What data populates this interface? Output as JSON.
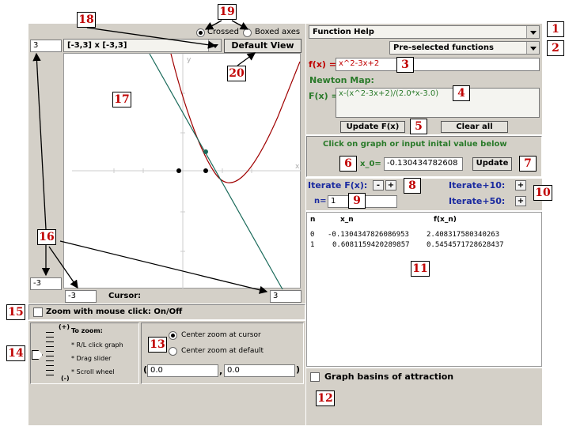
{
  "graph": {
    "left_max": "3",
    "left_min": "-3",
    "bottom_min": "-3",
    "bottom_max": "3",
    "window_select": "[-3,3] x [-3,3]",
    "default_view_label": "Default View",
    "cursor_label": "Cursor:",
    "axis_y_label": "y",
    "axis_x_label": "x",
    "axes_options": [
      "Crossed",
      "Boxed axes"
    ],
    "axes_selected": "Crossed"
  },
  "zoom": {
    "toggle_label": "Zoom with mouse click:  On/Off",
    "slider_plus": "(+)",
    "slider_minus": "(-)",
    "instructions_title": "To zoom:",
    "instructions": [
      "* R/L click graph",
      "* Drag slider",
      "* Scroll wheel"
    ],
    "center_options": [
      "Center zoom at cursor",
      "Center zoom at default"
    ],
    "center_selected": "Center zoom at cursor",
    "open_paren": "(",
    "coord_x": "0.0",
    "comma": ",",
    "coord_y": "0.0",
    "close_paren": ")"
  },
  "function_panel": {
    "help_select": "Function Help",
    "preselected_select": "Pre-selected functions",
    "fx_label": "f(x) =",
    "fx_value": "x^2-3x+2",
    "newton_map_label": "Newton Map:",
    "Fx_label": "F(x) =",
    "Fx_value": "x-(x^2-3x+2)/(2.0*x-3.0)",
    "update_button": "Update F(x)",
    "clear_button": "Clear all"
  },
  "initial": {
    "instruction": "Click on graph or input inital value below",
    "x0_label": "x_0=",
    "x0_value": "-0.130434782608",
    "update_button": "Update"
  },
  "iterate": {
    "label": "Iterate F(x):",
    "minus": "-",
    "plus": "+",
    "n_label": "n=",
    "n_value": "1",
    "iter10_label": "Iterate+10:",
    "iter50_label": "Iterate+50:"
  },
  "table": {
    "columns": [
      "n",
      "x_n",
      "f(x_n)"
    ],
    "rows": [
      [
        "0",
        "-0.1304347826086953",
        "2.408317580340263"
      ],
      [
        "1",
        "0.6081159420289857",
        "0.5454571728628437"
      ]
    ]
  },
  "basins": {
    "label": "Graph basins of attraction"
  },
  "callouts": [
    "1",
    "2",
    "3",
    "4",
    "5",
    "6",
    "7",
    "8",
    "9",
    "10",
    "11",
    "12",
    "13",
    "14",
    "15",
    "16",
    "17",
    "18",
    "19",
    "20"
  ],
  "colors": {
    "panel": "#d4d0c8",
    "callout_text": "#c00000",
    "label_green": "#2a7a2a",
    "label_red": "#c00000",
    "label_blue": "#1a2aa0"
  }
}
